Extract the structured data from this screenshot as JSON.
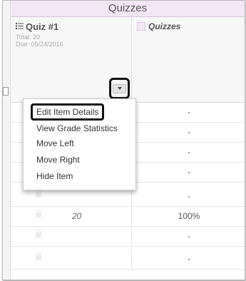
{
  "category_header": "Quizzes",
  "quiz_column": {
    "title": "Quiz #1",
    "total": "Total: 20",
    "due": "Due: 05/24/2016",
    "icon": "list-icon"
  },
  "category_column": {
    "title": "Quizzes",
    "swatch_color": "#f2e6f4"
  },
  "dropdown_icon": "chevron-down-icon",
  "menu": {
    "items": [
      {
        "label": "Edit Item Details"
      },
      {
        "label": "View Grade Statistics"
      },
      {
        "label": "Move Left"
      },
      {
        "label": "Move Right"
      },
      {
        "label": "Hide Item"
      }
    ]
  },
  "rows": [
    {
      "score": "",
      "category": "-"
    },
    {
      "score": "",
      "category": "-"
    },
    {
      "score": "",
      "category": "-"
    },
    {
      "score": "",
      "category": "-"
    },
    {
      "score": "",
      "category": "-"
    },
    {
      "score": "20",
      "category": "100%"
    },
    {
      "score": "",
      "category": "-"
    },
    {
      "score": "",
      "category": "-"
    }
  ],
  "colors": {
    "category_header_bg": "#f2e6f4",
    "highlight_border": "#111111"
  }
}
